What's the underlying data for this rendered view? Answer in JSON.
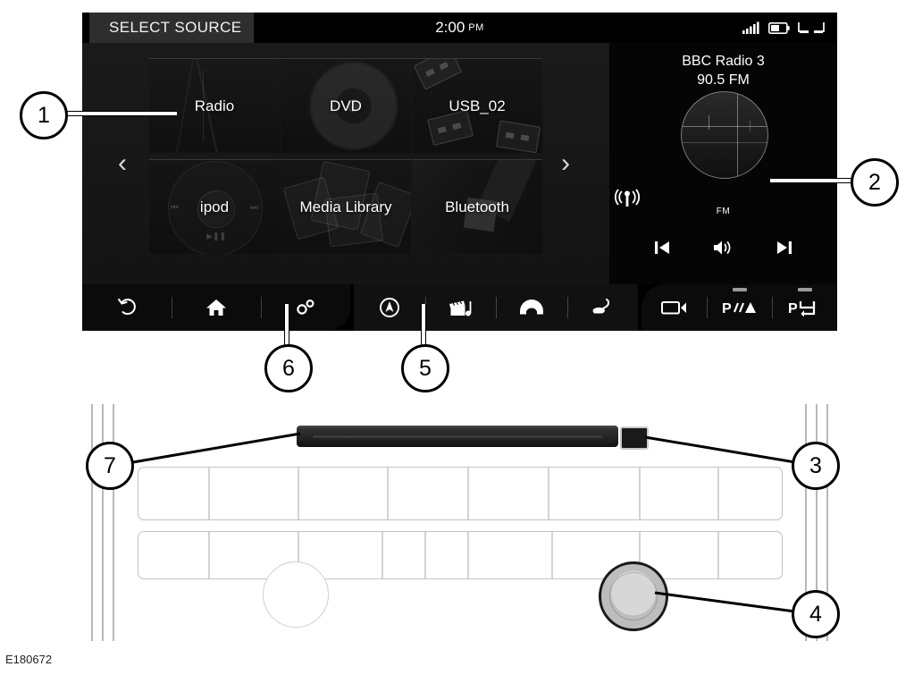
{
  "figure_id": "E180672",
  "screen": {
    "status_bar": {
      "source_tab_label": "SELECT SOURCE",
      "time": "2:00",
      "am_pm": "PM",
      "icons": [
        "signal-bars-icon",
        "battery-icon",
        "rear-seat-entertainment-icon"
      ]
    },
    "carousel": {
      "prev_label": "‹",
      "next_label": "›",
      "page_dots": [
        {
          "active": true
        },
        {
          "active": false
        },
        {
          "active": true
        },
        {
          "active": true
        },
        {
          "active": true
        }
      ]
    },
    "tiles": [
      {
        "label": "Radio",
        "art": "art-radio",
        "name": "source-tile-radio"
      },
      {
        "label": "DVD",
        "art": "art-dvd",
        "name": "source-tile-dvd"
      },
      {
        "label": "USB_02",
        "art": "art-usb",
        "name": "source-tile-usb"
      },
      {
        "label": "ipod",
        "art": "art-ipod",
        "name": "source-tile-ipod"
      },
      {
        "label": "Media Library",
        "art": "art-lib",
        "name": "source-tile-media-library"
      },
      {
        "label": "Bluetooth",
        "art": "art-bt",
        "name": "source-tile-bluetooth"
      }
    ],
    "now_playing": {
      "station": "BBC Radio 3",
      "frequency": "90.5 FM",
      "band": "FM",
      "controls": [
        "previous-track",
        "volume",
        "next-track"
      ]
    },
    "nav_bar": {
      "group1": [
        "back-icon",
        "home-icon",
        "settings-gears-icon"
      ],
      "group2": [
        "navigation-compass-icon",
        "media-clapperboard-icon",
        "phone-icon",
        "seat-climate-icon"
      ],
      "group3": [
        "camera-icon",
        "park-distance-icon",
        "park-assist-icon"
      ]
    }
  },
  "hardware": {
    "disc_slot": "cd-dvd-slot",
    "eject_button": "eject-button",
    "knob_left": "tuning-knob",
    "knob_right": "volume-knob"
  },
  "callouts": [
    {
      "number": "1",
      "target": "Radio source tile"
    },
    {
      "number": "2",
      "target": "Now playing radio panel"
    },
    {
      "number": "3",
      "target": "Eject button"
    },
    {
      "number": "4",
      "target": "Volume knob"
    },
    {
      "number": "5",
      "target": "Media icon"
    },
    {
      "number": "6",
      "target": "Settings icon"
    },
    {
      "number": "7",
      "target": "Disc slot"
    }
  ]
}
